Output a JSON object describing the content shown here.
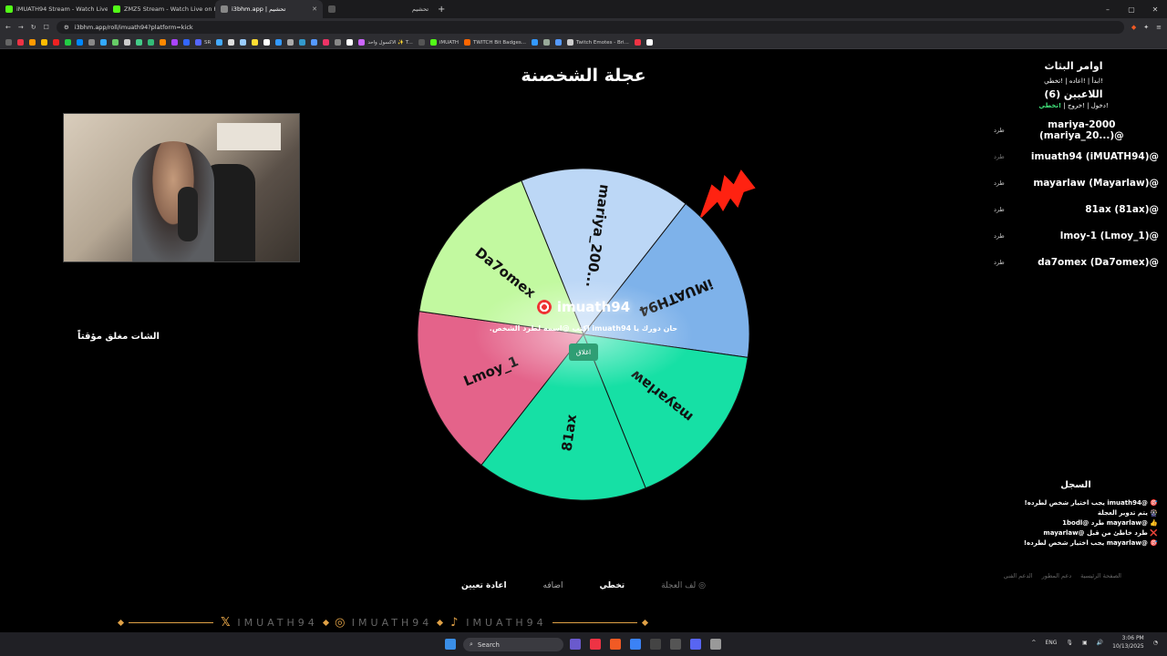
{
  "browser": {
    "tabs": [
      {
        "label": "iMUATH94 Stream - Watch Live o",
        "active": false
      },
      {
        "label": "ZMZ5 Stream - Watch Live on Kick",
        "active": false
      },
      {
        "label": "تحشيم",
        "active": false
      },
      {
        "label": "i3bhm.app | تحشيم",
        "active": true
      },
      {
        "label": "",
        "active": false
      },
      {
        "label": "تحشيم",
        "active": false
      }
    ],
    "url": "i3bhm.app/roll/imuath94?platform=kick",
    "bookmarks": [
      "SR",
      "الاكسول واحد ✨ T...",
      "iMUATH",
      "TWITCH Bit Badges...",
      "Twitch Emotes - Bri..."
    ]
  },
  "page": {
    "title": "عجلة الشخصنة",
    "chat_closed": "الشات مغلق مؤقتاً",
    "wheel": {
      "segments": [
        {
          "label": "mariya_200...",
          "color": "#bcd7f6"
        },
        {
          "label": "iMUATH94",
          "color": "#7eb2ea"
        },
        {
          "label": "mayarlaw",
          "color": "#16e0a5"
        },
        {
          "label": "81ax",
          "color": "#16e0a5"
        },
        {
          "label": "Lmoy_1",
          "color": "#e4638a"
        },
        {
          "label": "Da7omex",
          "color": "#c2f9a0"
        }
      ]
    },
    "winner": {
      "name": "imuath94",
      "message": "حان دورك يا imuath94 اكتب @اسمه لطرد الشخص.",
      "close_label": "اغلاق"
    },
    "right_panel": {
      "title": "اوامر البثاث",
      "commands": "!ابدأ | !اعاده | !تخطي",
      "players_title": "اللاعبين (6)",
      "actions_join": "!دخول",
      "actions_exit": "!خروج",
      "actions_skip": "!تخطي",
      "kick_label": "طرد",
      "players": [
        {
          "name": "mariya-2000 (mariya_20...)@"
        },
        {
          "name": "imuath94 (iMUATH94)@"
        },
        {
          "name": "mayarlaw (Mayarlaw)@"
        },
        {
          "name": "81ax (81ax)@"
        },
        {
          "name": "lmoy-1 (Lmoy_1)@"
        },
        {
          "name": "da7omex (Da7omex)@"
        }
      ]
    },
    "log": {
      "title": "السجل",
      "items": [
        "🎯 @imuath94 يجب اختيار شخص لطرده!",
        "🎡 يتم تدوير العجلة",
        "👍 @mayarlaw طرد @1bodl",
        "❌ طرد خاطئ من قبل @mayarlaw",
        "🎯 @mayarlaw يجب اختيار شخص لطرده!"
      ]
    },
    "footer_links": [
      "الصفحة الرئيسية",
      "دعم المطور",
      "الدعم الفني"
    ],
    "controls": {
      "reset": "اعادة تعيين",
      "add": "اضافه",
      "skip": "تخطي",
      "spin": "لف العجلة"
    },
    "socials": {
      "handle": "IMUATH94"
    }
  },
  "taskbar": {
    "search_placeholder": "Search",
    "lang": "ENG",
    "time": "3:06 PM",
    "date": "10/13/2025"
  }
}
